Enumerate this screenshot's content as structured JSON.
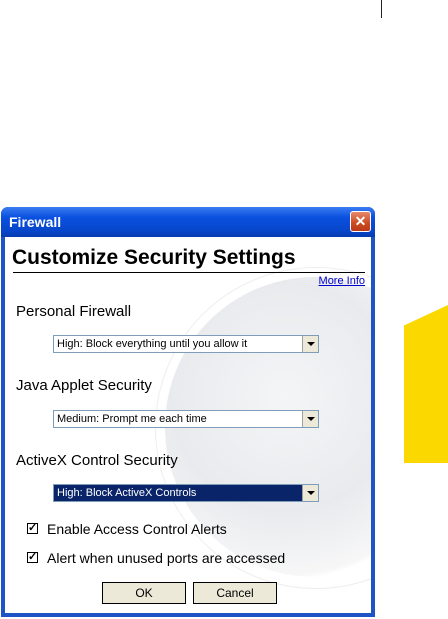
{
  "window": {
    "title": "Firewall",
    "close_label": "✕"
  },
  "dialog": {
    "heading": "Customize Security Settings",
    "more_info": "More Info",
    "sections": [
      {
        "label": "Personal Firewall",
        "selected": "High: Block everything until you allow it"
      },
      {
        "label": "Java Applet Security",
        "selected": "Medium: Prompt me each time"
      },
      {
        "label": "ActiveX Control Security",
        "selected": "High: Block ActiveX Controls"
      }
    ],
    "checkboxes": [
      {
        "label": "Enable Access Control Alerts",
        "checked": true,
        "mark": "✓"
      },
      {
        "label": "Alert when unused ports are accessed",
        "checked": true,
        "mark": "✓"
      }
    ],
    "ok_label": "OK",
    "cancel_label": "Cancel"
  },
  "colors": {
    "titlebar": "#0a50e0",
    "tab_accent": "#fbd800",
    "select_highlight": "#0a246a"
  }
}
